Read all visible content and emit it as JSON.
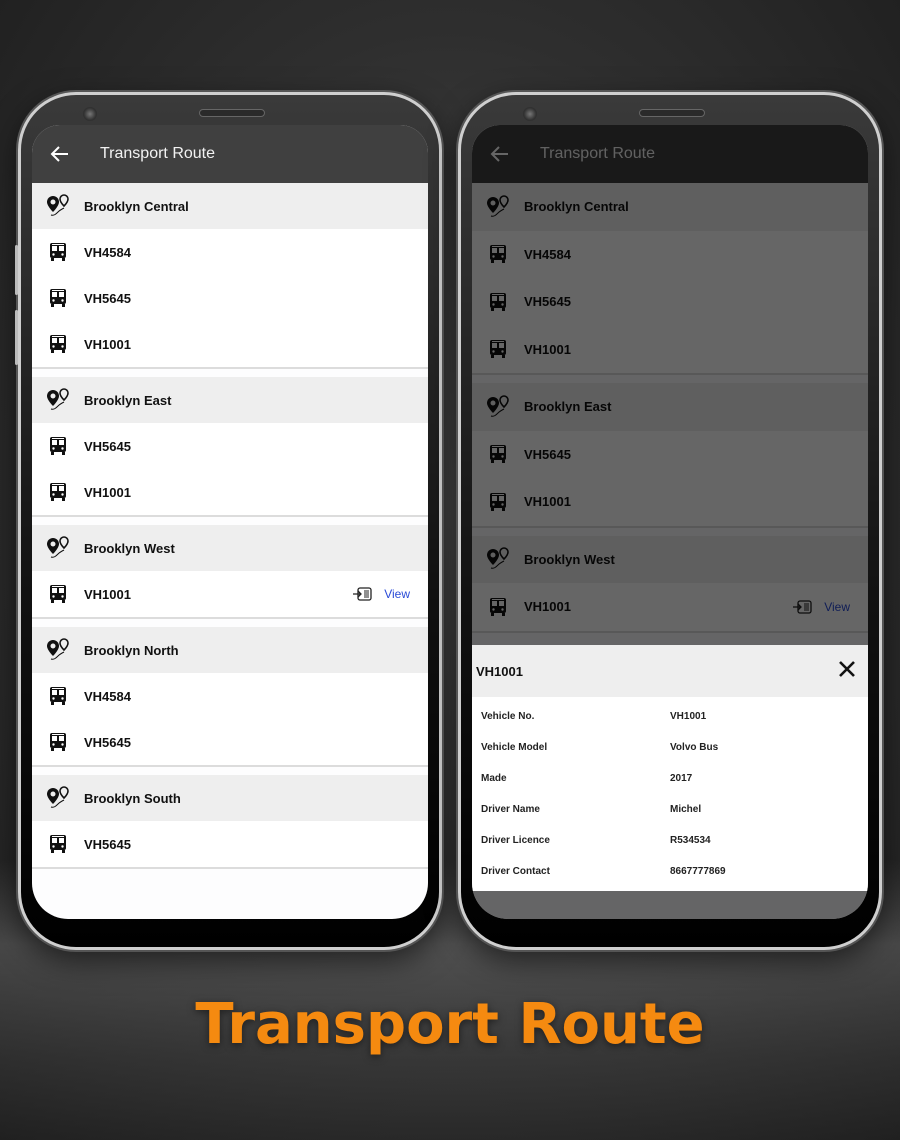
{
  "app": {
    "title": "Transport Route",
    "accent_color": "#f58a10",
    "link_color": "#2a4bd7"
  },
  "caption": "Transport Route",
  "left_screen": {
    "appbar": {
      "title": "Transport Route",
      "back_icon": "arrow-left-icon"
    },
    "routes": [
      {
        "name": "Brooklyn Central",
        "vehicles": [
          {
            "id": "VH4584"
          },
          {
            "id": "VH5645"
          },
          {
            "id": "VH1001"
          }
        ]
      },
      {
        "name": "Brooklyn East",
        "vehicles": [
          {
            "id": "VH5645"
          },
          {
            "id": "VH1001"
          }
        ]
      },
      {
        "name": "Brooklyn West",
        "vehicles": [
          {
            "id": "VH1001",
            "action": "View"
          }
        ]
      },
      {
        "name": "Brooklyn North",
        "vehicles": [
          {
            "id": "VH4584"
          },
          {
            "id": "VH5645"
          }
        ]
      },
      {
        "name": "Brooklyn South",
        "vehicles": [
          {
            "id": "VH5645"
          }
        ]
      }
    ]
  },
  "right_screen": {
    "appbar": {
      "title": "Transport Route"
    },
    "routes": [
      {
        "name": "Brooklyn Central",
        "vehicles": [
          {
            "id": "VH4584"
          },
          {
            "id": "VH5645"
          },
          {
            "id": "VH1001"
          }
        ]
      },
      {
        "name": "Brooklyn East",
        "vehicles": [
          {
            "id": "VH5645"
          },
          {
            "id": "VH1001"
          }
        ]
      },
      {
        "name": "Brooklyn West",
        "vehicles": [
          {
            "id": "VH1001",
            "action": "View"
          }
        ]
      }
    ],
    "dialog": {
      "title": "VH1001",
      "close_icon": "close-icon",
      "details": [
        {
          "label": "Vehicle No.",
          "value": "VH1001"
        },
        {
          "label": "Vehicle Model",
          "value": "Volvo Bus"
        },
        {
          "label": "Made",
          "value": "2017"
        },
        {
          "label": "Driver Name",
          "value": "Michel"
        },
        {
          "label": "Driver Licence",
          "value": "R534534"
        },
        {
          "label": "Driver Contact",
          "value": "8667777869"
        }
      ]
    }
  }
}
